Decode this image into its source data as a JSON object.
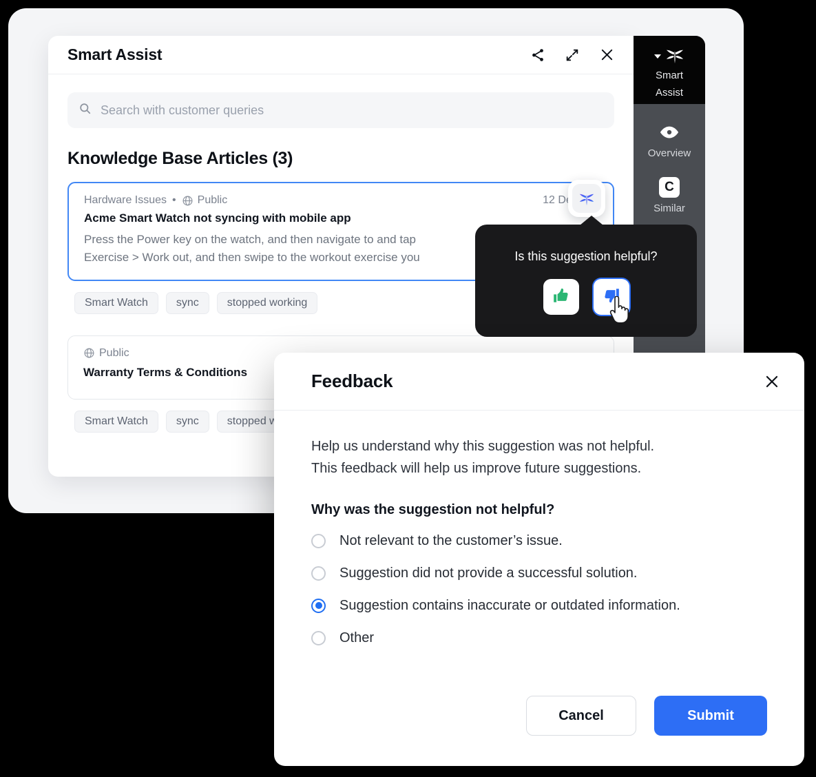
{
  "window": {
    "title": "Smart Assist",
    "header_icons": [
      {
        "name": "share-icon",
        "label": "Share"
      },
      {
        "name": "expand-icon",
        "label": "Expand"
      },
      {
        "name": "close-icon",
        "label": "Close"
      }
    ]
  },
  "search": {
    "placeholder": "Search with customer queries",
    "value": "",
    "icon": "search-icon"
  },
  "knowledge_base": {
    "section_title": "Knowledge Base Articles (3)",
    "articles": [
      {
        "category": "Hardware Issues",
        "separator": "•",
        "visibility": "Public",
        "visibility_icon": "globe-icon",
        "date": "12 Dec 202",
        "title": "Acme Smart Watch not syncing with mobile app",
        "snippet_line_1": "Press the Power key on the watch, and then navigate to and tap",
        "snippet_line_2": "Exercise > Work out, and then swipe to the workout exercise you",
        "selected": true,
        "tags": [
          "Smart Watch",
          "sync",
          "stopped working"
        ]
      },
      {
        "category": "",
        "separator": "",
        "visibility": "Public",
        "visibility_icon": "globe-icon",
        "date": "",
        "title": "Warranty Terms & Conditions",
        "snippet_line_1": "",
        "snippet_line_2": "",
        "selected": false,
        "tags": [
          "Smart Watch",
          "sync",
          "stopped working"
        ]
      }
    ]
  },
  "rail": {
    "brand_label_line1": "Smart",
    "brand_label_line2": "Assist",
    "brand_icon": "sprout-leaf-icon",
    "caret_icon": "caret-down-icon",
    "items": [
      {
        "label": "Overview",
        "icon": "eye-icon"
      },
      {
        "label": "Similar",
        "icon": "c-badge-icon"
      },
      {
        "label": "",
        "icon": "hierarchy-icon"
      }
    ]
  },
  "leaf_badge": {
    "icon": "sprout-leaf-icon"
  },
  "tooltip": {
    "question": "Is this suggestion helpful?",
    "thumbs_up": {
      "icon": "thumbs-up-icon",
      "color": "#2bb673"
    },
    "thumbs_down": {
      "icon": "thumbs-down-icon",
      "color": "#2d6ef5",
      "focused": true
    },
    "cursor": "hand-cursor-icon"
  },
  "feedback_dialog": {
    "title": "Feedback",
    "close_icon": "close-icon",
    "intro_line_1": "Help us understand why this suggestion was not helpful.",
    "intro_line_2": "This feedback will help us improve future suggestions.",
    "question": "Why was the suggestion not helpful?",
    "options": [
      {
        "label": "Not relevant to the customer’s issue.",
        "selected": false
      },
      {
        "label": "Suggestion did not provide a successful solution.",
        "selected": false
      },
      {
        "label": "Suggestion contains inaccurate or outdated information.",
        "selected": true
      },
      {
        "label": "Other",
        "selected": false
      }
    ],
    "cancel_label": "Cancel",
    "submit_label": "Submit"
  },
  "colors": {
    "accent_blue": "#2d6ef5",
    "selected_card_border": "#4187f5",
    "thumbs_up_green": "#2bb673",
    "rail_dark": "#4a4d52",
    "rail_header_black": "#050505",
    "tooltip_black": "#19191b"
  }
}
